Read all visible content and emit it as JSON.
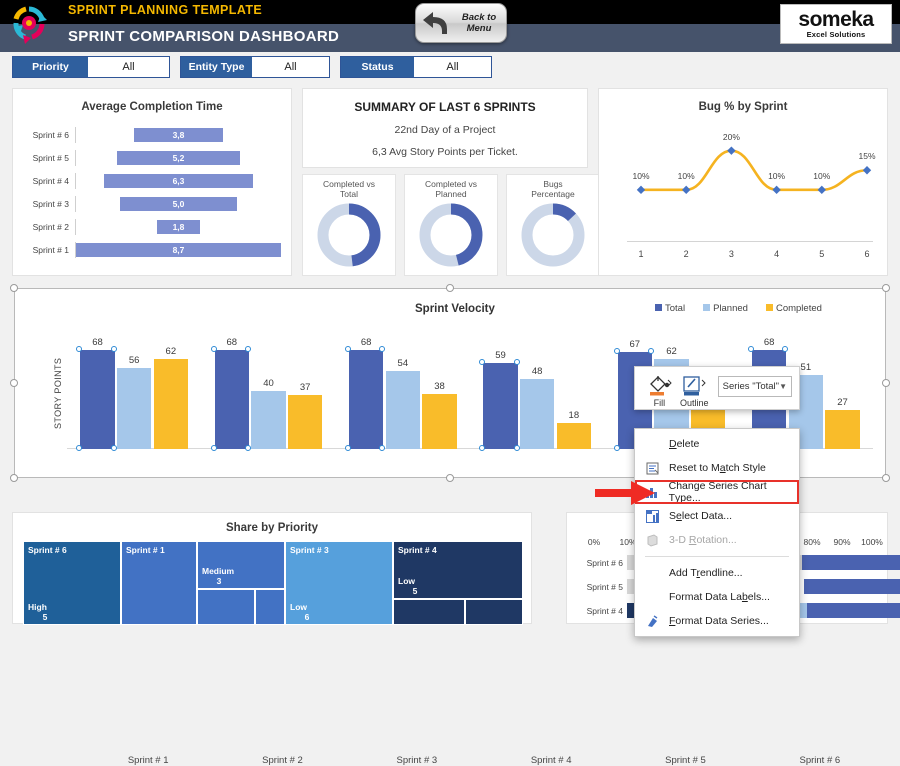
{
  "header": {
    "template_title": "SPRINT PLANNING TEMPLATE",
    "dashboard_title": "SPRINT COMPARISON DASHBOARD",
    "back_button": {
      "line1": "Back to",
      "line2": "Menu",
      "icon": "back-arrow-icon"
    },
    "brand": {
      "name": "someka",
      "tagline": "Excel Solutions"
    },
    "logo_icon": "sprint-cycle-logo-icon"
  },
  "filters": [
    {
      "key": "Priority",
      "value": "All"
    },
    {
      "key": "Entity Type",
      "value": "All"
    },
    {
      "key": "Status",
      "value": "All"
    }
  ],
  "avg_completion": {
    "title": "Average Completion Time",
    "rows": [
      {
        "label": "Sprint # 6",
        "value": "3,8",
        "num": 3.8
      },
      {
        "label": "Sprint # 5",
        "value": "5,2",
        "num": 5.2
      },
      {
        "label": "Sprint # 4",
        "value": "6,3",
        "num": 6.3
      },
      {
        "label": "Sprint # 3",
        "value": "5,0",
        "num": 5.0
      },
      {
        "label": "Sprint # 2",
        "value": "1,8",
        "num": 1.8
      },
      {
        "label": "Sprint # 1",
        "value": "8,7",
        "num": 8.7
      }
    ]
  },
  "summary": {
    "title": "SUMMARY OF LAST 6 SPRINTS",
    "line1": "22nd Day of a Project",
    "line2": "6,3 Avg Story Points per Ticket.",
    "donuts": [
      {
        "label_line1": "Completed vs",
        "label_line2": "Total",
        "percent": 48
      },
      {
        "label_line1": "Completed vs",
        "label_line2": "Planned",
        "percent": 46
      },
      {
        "label_line1": "Bugs",
        "label_line2": "Percentage",
        "percent": 13
      }
    ]
  },
  "bug_chart": {
    "title": "Bug % by Sprint",
    "xticks": [
      "1",
      "2",
      "3",
      "4",
      "5",
      "6"
    ],
    "labels": [
      "10%",
      "10%",
      "20%",
      "10%",
      "10%",
      "15%"
    ],
    "values": [
      10,
      10,
      20,
      10,
      10,
      15
    ]
  },
  "velocity": {
    "title": "Sprint Velocity",
    "ylabel": "STORY POINTS",
    "legend": [
      {
        "name": "Total",
        "color": "#4a62b0"
      },
      {
        "name": "Planned",
        "color": "#a5c7ea"
      },
      {
        "name": "Completed",
        "color": "#f9bc2a"
      }
    ],
    "categories": [
      "Sprint # 1",
      "Sprint # 2",
      "Sprint # 3",
      "Sprint # 4",
      "Sprint # 5",
      "Sprint # 6"
    ],
    "series": [
      {
        "name": "Total",
        "values": [
          68,
          68,
          68,
          59,
          67,
          68
        ]
      },
      {
        "name": "Planned",
        "values": [
          56,
          40,
          54,
          48,
          62,
          51
        ]
      },
      {
        "name": "Completed",
        "values": [
          62,
          37,
          38,
          18,
          44,
          27
        ]
      }
    ],
    "ymax": 80,
    "selected_series": "Total"
  },
  "treemap": {
    "title": "Share by Priority",
    "cells": [
      {
        "sprint": "Sprint # 6",
        "priority": "High",
        "count": "5",
        "color": "#1f6099"
      },
      {
        "sprint": "Sprint # 1",
        "priority": "",
        "count": "",
        "color": "#4272c4"
      },
      {
        "sprint": "",
        "priority": "Medium",
        "count": "3",
        "color": "#4272c4"
      },
      {
        "sprint": "",
        "priority": "",
        "count": "",
        "color": "#4272c4"
      },
      {
        "sprint": "",
        "priority": "",
        "count": "",
        "color": "#4272c4"
      },
      {
        "sprint": "Sprint # 3",
        "priority": "Low",
        "count": "6",
        "color": "#56a0dc"
      },
      {
        "sprint": "Sprint # 4",
        "priority": "Low",
        "count": "5",
        "color": "#1f3864"
      },
      {
        "sprint": "",
        "priority": "",
        "count": "",
        "color": "#1f3864"
      },
      {
        "sprint": "",
        "priority": "",
        "count": "",
        "color": "#1f3864"
      }
    ]
  },
  "bottom_right": {
    "xticks": [
      "0%",
      "10%",
      "80%",
      "90%",
      "100%"
    ],
    "rows": [
      "Sprint # 6",
      "Sprint # 5",
      "Sprint # 4"
    ]
  },
  "mini_toolbar": {
    "fill": {
      "label": "Fill",
      "icon": "fill-bucket-icon",
      "chevron": "chevron-down-icon",
      "swatch": "#ed7d31"
    },
    "outline": {
      "label": "Outline",
      "icon": "outline-pen-icon",
      "chevron": "chevron-down-icon",
      "swatch": "#2f5f9e"
    },
    "series_select": {
      "value": "Series \"Total\"",
      "chevron": "chevron-down-icon"
    }
  },
  "context_menu": {
    "items": [
      {
        "label": "Delete",
        "icon": "",
        "underline": "D",
        "disabled": false,
        "highlighted": false,
        "separator_after": false
      },
      {
        "label": "Reset to Match Style",
        "icon": "reset-style-icon",
        "underline": "a",
        "disabled": false,
        "highlighted": false,
        "separator_after": false
      },
      {
        "label": "Change Series Chart Type...",
        "icon": "chart-type-icon",
        "underline": "y",
        "disabled": false,
        "highlighted": true,
        "separator_after": false
      },
      {
        "label": "Select Data...",
        "icon": "select-data-icon",
        "underline": "e",
        "disabled": false,
        "highlighted": false,
        "separator_after": false
      },
      {
        "label": "3-D Rotation...",
        "icon": "rotation-3d-icon",
        "underline": "R",
        "disabled": true,
        "highlighted": false,
        "separator_after": true
      },
      {
        "label": "Add Trendline...",
        "icon": "",
        "underline": "r",
        "disabled": false,
        "highlighted": false,
        "separator_after": false
      },
      {
        "label": "Format Data Labels...",
        "icon": "",
        "underline": "b",
        "disabled": false,
        "highlighted": false,
        "separator_after": false
      },
      {
        "label": "Format Data Series...",
        "icon": "format-series-icon",
        "underline": "F",
        "disabled": false,
        "highlighted": false,
        "separator_after": false
      }
    ],
    "pointer": {
      "icon": "red-arrow-pointer",
      "color": "#ef2b24"
    }
  }
}
